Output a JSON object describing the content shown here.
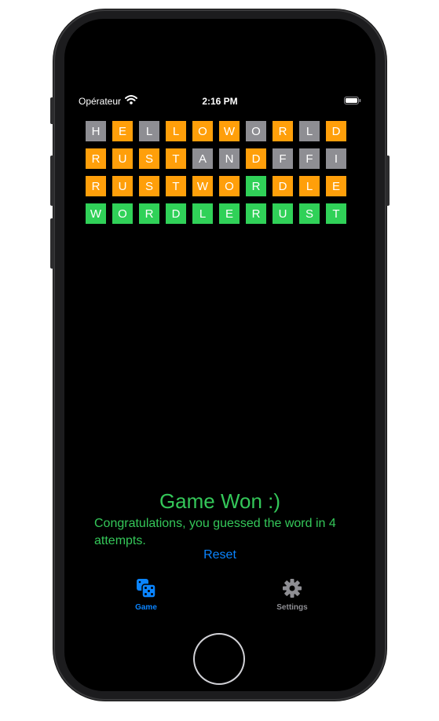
{
  "status_bar": {
    "carrier": "Opérateur",
    "time": "2:16 PM"
  },
  "board": {
    "rows": [
      [
        {
          "letter": "H",
          "state": "gray"
        },
        {
          "letter": "E",
          "state": "orange"
        },
        {
          "letter": "L",
          "state": "gray"
        },
        {
          "letter": "L",
          "state": "orange"
        },
        {
          "letter": "O",
          "state": "orange"
        },
        {
          "letter": "W",
          "state": "orange"
        },
        {
          "letter": "O",
          "state": "gray"
        },
        {
          "letter": "R",
          "state": "orange"
        },
        {
          "letter": "L",
          "state": "gray"
        },
        {
          "letter": "D",
          "state": "orange"
        }
      ],
      [
        {
          "letter": "R",
          "state": "orange"
        },
        {
          "letter": "U",
          "state": "orange"
        },
        {
          "letter": "S",
          "state": "orange"
        },
        {
          "letter": "T",
          "state": "orange"
        },
        {
          "letter": "A",
          "state": "gray"
        },
        {
          "letter": "N",
          "state": "gray"
        },
        {
          "letter": "D",
          "state": "orange"
        },
        {
          "letter": "F",
          "state": "gray"
        },
        {
          "letter": "F",
          "state": "gray"
        },
        {
          "letter": "I",
          "state": "gray"
        }
      ],
      [
        {
          "letter": "R",
          "state": "orange"
        },
        {
          "letter": "U",
          "state": "orange"
        },
        {
          "letter": "S",
          "state": "orange"
        },
        {
          "letter": "T",
          "state": "orange"
        },
        {
          "letter": "W",
          "state": "orange"
        },
        {
          "letter": "O",
          "state": "orange"
        },
        {
          "letter": "R",
          "state": "green"
        },
        {
          "letter": "D",
          "state": "orange"
        },
        {
          "letter": "L",
          "state": "orange"
        },
        {
          "letter": "E",
          "state": "orange"
        }
      ],
      [
        {
          "letter": "W",
          "state": "green"
        },
        {
          "letter": "O",
          "state": "green"
        },
        {
          "letter": "R",
          "state": "green"
        },
        {
          "letter": "D",
          "state": "green"
        },
        {
          "letter": "L",
          "state": "green"
        },
        {
          "letter": "E",
          "state": "green"
        },
        {
          "letter": "R",
          "state": "green"
        },
        {
          "letter": "U",
          "state": "green"
        },
        {
          "letter": "S",
          "state": "green"
        },
        {
          "letter": "T",
          "state": "green"
        }
      ]
    ]
  },
  "result": {
    "title": "Game Won :)",
    "message": "Congratulations, you guessed the word in 4 attempts.",
    "reset_label": "Reset"
  },
  "tab_bar": {
    "game": {
      "label": "Game",
      "icon": "dice-icon"
    },
    "settings": {
      "label": "Settings",
      "icon": "gear-icon"
    }
  },
  "colors": {
    "gray": "#8e8e93",
    "orange": "#ff9f0a",
    "green": "#30d158",
    "accent": "#0a84ff",
    "success_text": "#34c759"
  }
}
